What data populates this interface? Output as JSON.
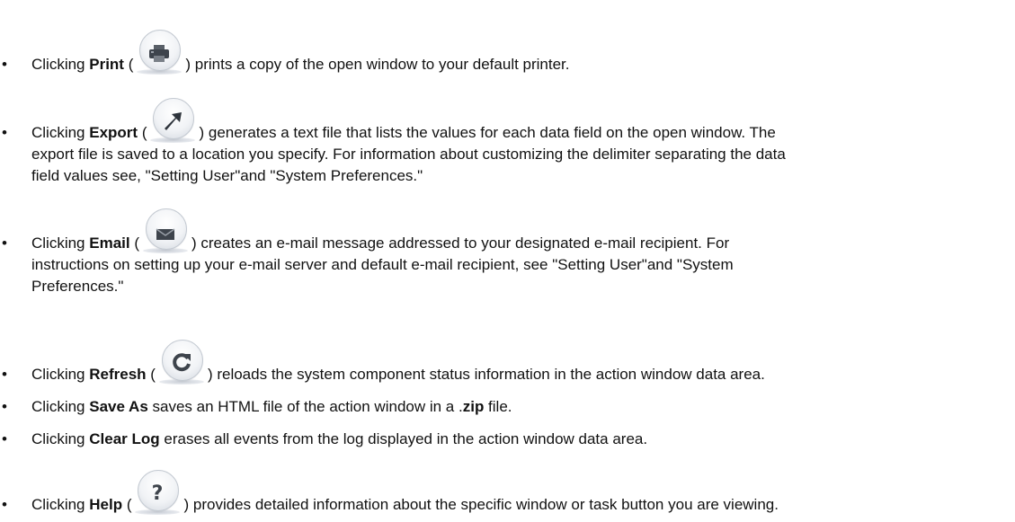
{
  "items": [
    {
      "prefix": "Clicking ",
      "label": "Print",
      "icon": "printer-icon",
      "lines": [
        ") prints a copy of the open window to your default printer."
      ]
    },
    {
      "prefix": "Clicking ",
      "label": "Export",
      "icon": "export-arrow-icon",
      "lines": [
        ") generates a text file that lists the values for each data field on the open window. The",
        "export file is saved to a location you specify. For information about customizing the delimiter separating the data",
        "field values see, \"Setting User\"and \"System Preferences.\""
      ]
    },
    {
      "prefix": "Clicking ",
      "label": "Email",
      "icon": "envelope-icon",
      "lines": [
        ") creates an e-mail message addressed to your designated e-mail recipient. For",
        "instructions on setting up your e-mail server and default e-mail recipient, see \"Setting User\"and \"System",
        "Preferences.\""
      ]
    },
    {
      "prefix": "Clicking ",
      "label": "Refresh",
      "icon": "refresh-icon",
      "lines": [
        ") reloads the system component status information in the action window data area."
      ]
    },
    {
      "prefix": "Clicking ",
      "label": "Save As",
      "middle": " saves an HTML file of the action window in a .",
      "bold2": "zip",
      "suffix": " file."
    },
    {
      "prefix": "Clicking ",
      "label": "Clear Log",
      "middle": " erases all events from the log displayed in the action window data area."
    },
    {
      "prefix": "Clicking ",
      "label": "Help",
      "icon": "help-icon",
      "lines": [
        ") provides detailed information about the specific window or task button you are viewing."
      ]
    }
  ],
  "bullet": "•",
  "open_paren": " ("
}
